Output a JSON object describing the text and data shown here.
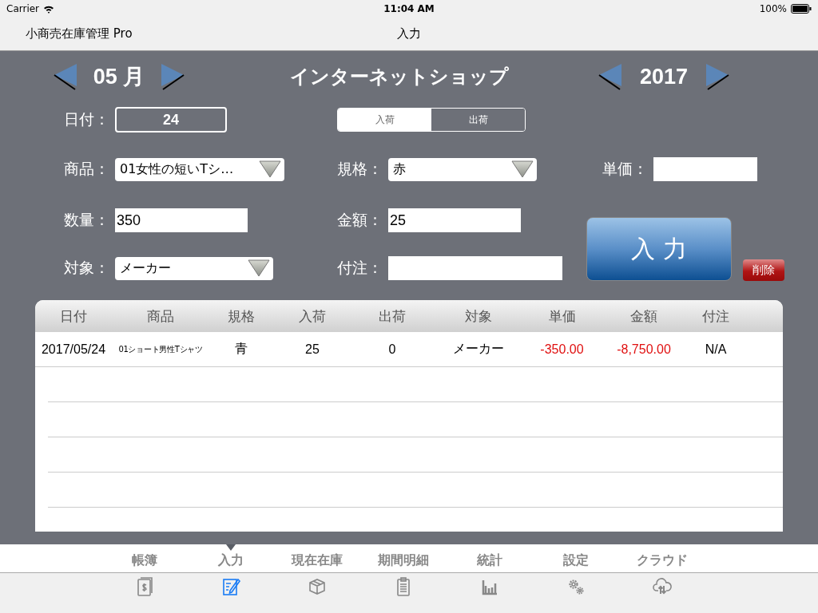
{
  "status_bar": {
    "carrier": "Carrier",
    "time": "11:04 AM",
    "battery": "100%"
  },
  "nav_bar": {
    "app_name": "小商売在庫管理 Pro",
    "title": "入力"
  },
  "header": {
    "month": "05 月",
    "shop": "インターネットショップ",
    "year": "2017"
  },
  "form": {
    "date": {
      "label": "日付：",
      "value": "24"
    },
    "direction": [
      {
        "label": "入荷",
        "selected": true
      },
      {
        "label": "出荷",
        "selected": false
      }
    ],
    "product": {
      "label": "商品：",
      "value": "01女性の短いTシ…"
    },
    "spec": {
      "label": "規格：",
      "value": "赤"
    },
    "unit_price": {
      "label": "単価："
    },
    "quantity": {
      "label": "数量：",
      "value": "350"
    },
    "amount": {
      "label": "金額：",
      "value": "25"
    },
    "partner": {
      "label": "対象：",
      "value": "メーカー"
    },
    "note": {
      "label": "付注："
    },
    "enter_button": "入 力",
    "delete_button": "削除"
  },
  "table": {
    "columns": [
      "日付",
      "商品",
      "規格",
      "入荷",
      "出荷",
      "対象",
      "単価",
      "金額",
      "付注"
    ],
    "rows": [
      {
        "cells": [
          {
            "text": "2017/05/24",
            "kind": "text"
          },
          {
            "text": "01ショート男性Tシャツ",
            "kind": "small"
          },
          {
            "text": "青",
            "kind": "text"
          },
          {
            "text": "25",
            "kind": "text"
          },
          {
            "text": "0",
            "kind": "text"
          },
          {
            "text": "メーカー",
            "kind": "text"
          },
          {
            "text": "-350.00",
            "kind": "negative"
          },
          {
            "text": "-8,750.00",
            "kind": "negative"
          },
          {
            "text": "N/A",
            "kind": "text"
          }
        ]
      }
    ]
  },
  "tabs": [
    {
      "label": "帳簿",
      "selected": false
    },
    {
      "label": "入力",
      "selected": true
    },
    {
      "label": "現在在庫",
      "selected": false
    },
    {
      "label": "期間明細",
      "selected": false
    },
    {
      "label": "統計",
      "selected": false
    },
    {
      "label": "設定",
      "selected": false
    },
    {
      "label": "クラウド",
      "selected": false
    }
  ]
}
